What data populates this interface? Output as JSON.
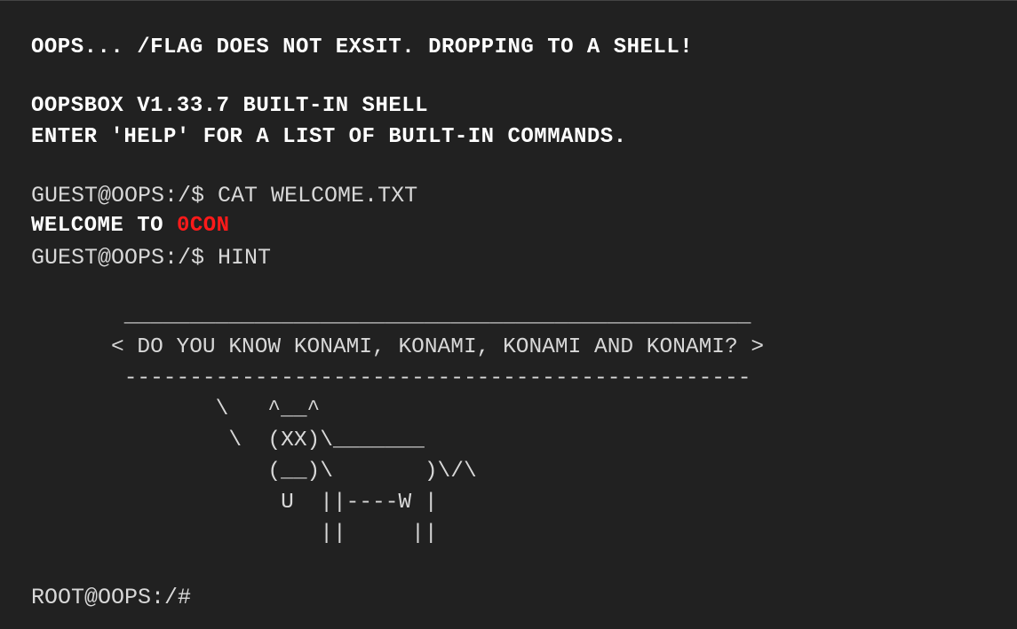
{
  "terminal": {
    "error_line": "OOPS... /FLAG DOES NOT EXSIT. DROPPING TO A SHELL!",
    "banner_line1": "OOPSBOX V1.33.7 BUILT-IN SHELL",
    "banner_line2": "ENTER 'HELP' FOR A LIST OF BUILT-IN COMMANDS.",
    "cmd1": "GUEST@OOPS:/$ CAT WELCOME.TXT",
    "welcome_prefix": "WELCOME TO ",
    "welcome_accent": "0CON",
    "cmd2": "GUEST@OOPS:/$ HINT",
    "cowsay": " ________________________________________________\n< DO YOU KNOW KONAMI, KONAMI, KONAMI AND KONAMI? >\n ------------------------------------------------\n        \\   ^__^\n         \\  (XX)\\_______\n            (__)\\       )\\/\\\n             U  ||----W |\n                ||     ||",
    "root_prompt": "ROOT@OOPS:/#"
  },
  "colors": {
    "background": "#212121",
    "text": "#ffffff",
    "accent": "#ff1a1a"
  }
}
